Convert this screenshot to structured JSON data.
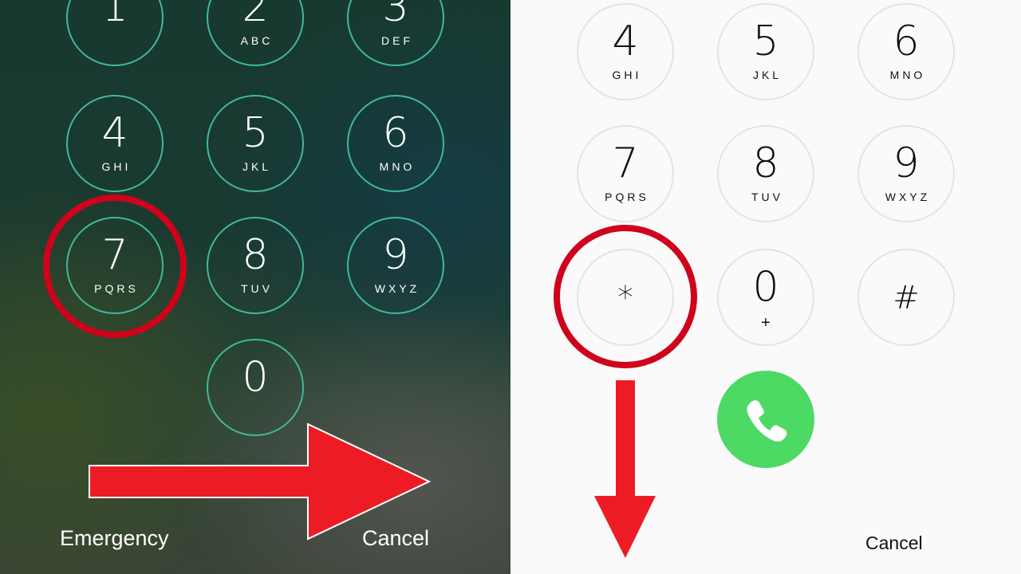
{
  "lock_screen": {
    "keys": [
      {
        "digit": "1",
        "letters": ""
      },
      {
        "digit": "2",
        "letters": "ABC"
      },
      {
        "digit": "3",
        "letters": "DEF"
      },
      {
        "digit": "4",
        "letters": "GHI"
      },
      {
        "digit": "5",
        "letters": "JKL"
      },
      {
        "digit": "6",
        "letters": "MNO"
      },
      {
        "digit": "7",
        "letters": "PQRS"
      },
      {
        "digit": "8",
        "letters": "TUV"
      },
      {
        "digit": "9",
        "letters": "WXYZ"
      },
      {
        "digit": "0",
        "letters": ""
      }
    ],
    "emergency_label": "Emergency",
    "cancel_label": "Cancel",
    "highlighted_key": "7"
  },
  "dialer": {
    "keys": [
      {
        "digit": "4",
        "letters": "GHI"
      },
      {
        "digit": "5",
        "letters": "JKL"
      },
      {
        "digit": "6",
        "letters": "MNO"
      },
      {
        "digit": "7",
        "letters": "PQRS"
      },
      {
        "digit": "8",
        "letters": "TUV"
      },
      {
        "digit": "9",
        "letters": "WXYZ"
      },
      {
        "digit": "*",
        "letters": ""
      },
      {
        "digit": "0",
        "letters": "+"
      },
      {
        "digit": "#",
        "letters": ""
      }
    ],
    "call_icon": "phone-icon",
    "cancel_label": "Cancel",
    "highlighted_key": "*"
  },
  "colors": {
    "highlight_ring": "#d0021b",
    "arrow": "#ed1c24",
    "call_button": "#4cd964",
    "lock_key_border": "#3fb99a"
  }
}
